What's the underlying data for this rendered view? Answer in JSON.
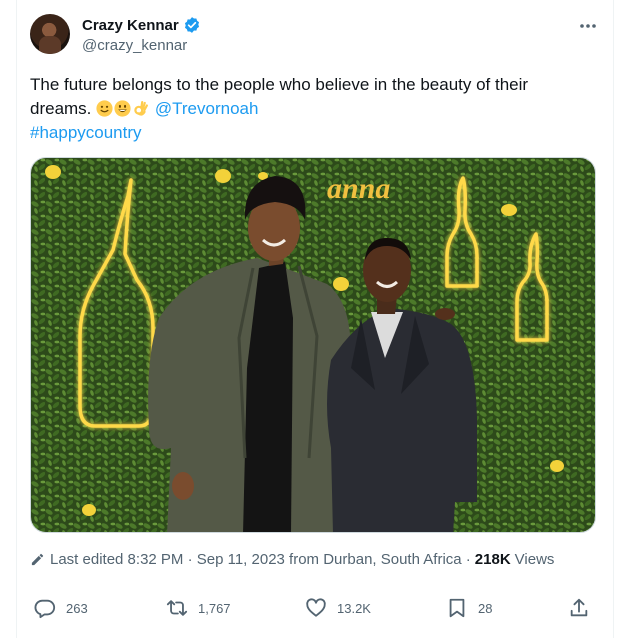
{
  "tweet": {
    "author": {
      "display_name": "Crazy Kennar",
      "handle": "@crazy_kennar",
      "verified": true
    },
    "text_main": "The future belongs to the people who believe in the beauty of their dreams. ",
    "emojis": [
      "slightly-smiling-face",
      "grinning-face",
      "ok-hand"
    ],
    "mention": "@Trevornoah",
    "hashtag": "#happycountry",
    "image_sign_text": "anna",
    "edited_label": "Last edited 8:32 PM · Sep 11, 2023 from Durban, South Africa · ",
    "views_count": "218K",
    "views_label": "Views"
  },
  "actions": {
    "replies": "263",
    "reposts": "1,767",
    "likes": "13.2K",
    "bookmarks": "28"
  },
  "colors": {
    "accent": "#1d9bf0",
    "secondary_text": "#536471",
    "primary_text": "#0f1419",
    "neon": "#ffd94a"
  },
  "icons": {
    "verified": "verified-badge-icon",
    "more": "more-options-icon",
    "edit": "pencil-icon",
    "reply": "reply-icon",
    "repost": "repost-icon",
    "like": "heart-icon",
    "bookmark": "bookmark-icon",
    "share": "share-icon"
  }
}
